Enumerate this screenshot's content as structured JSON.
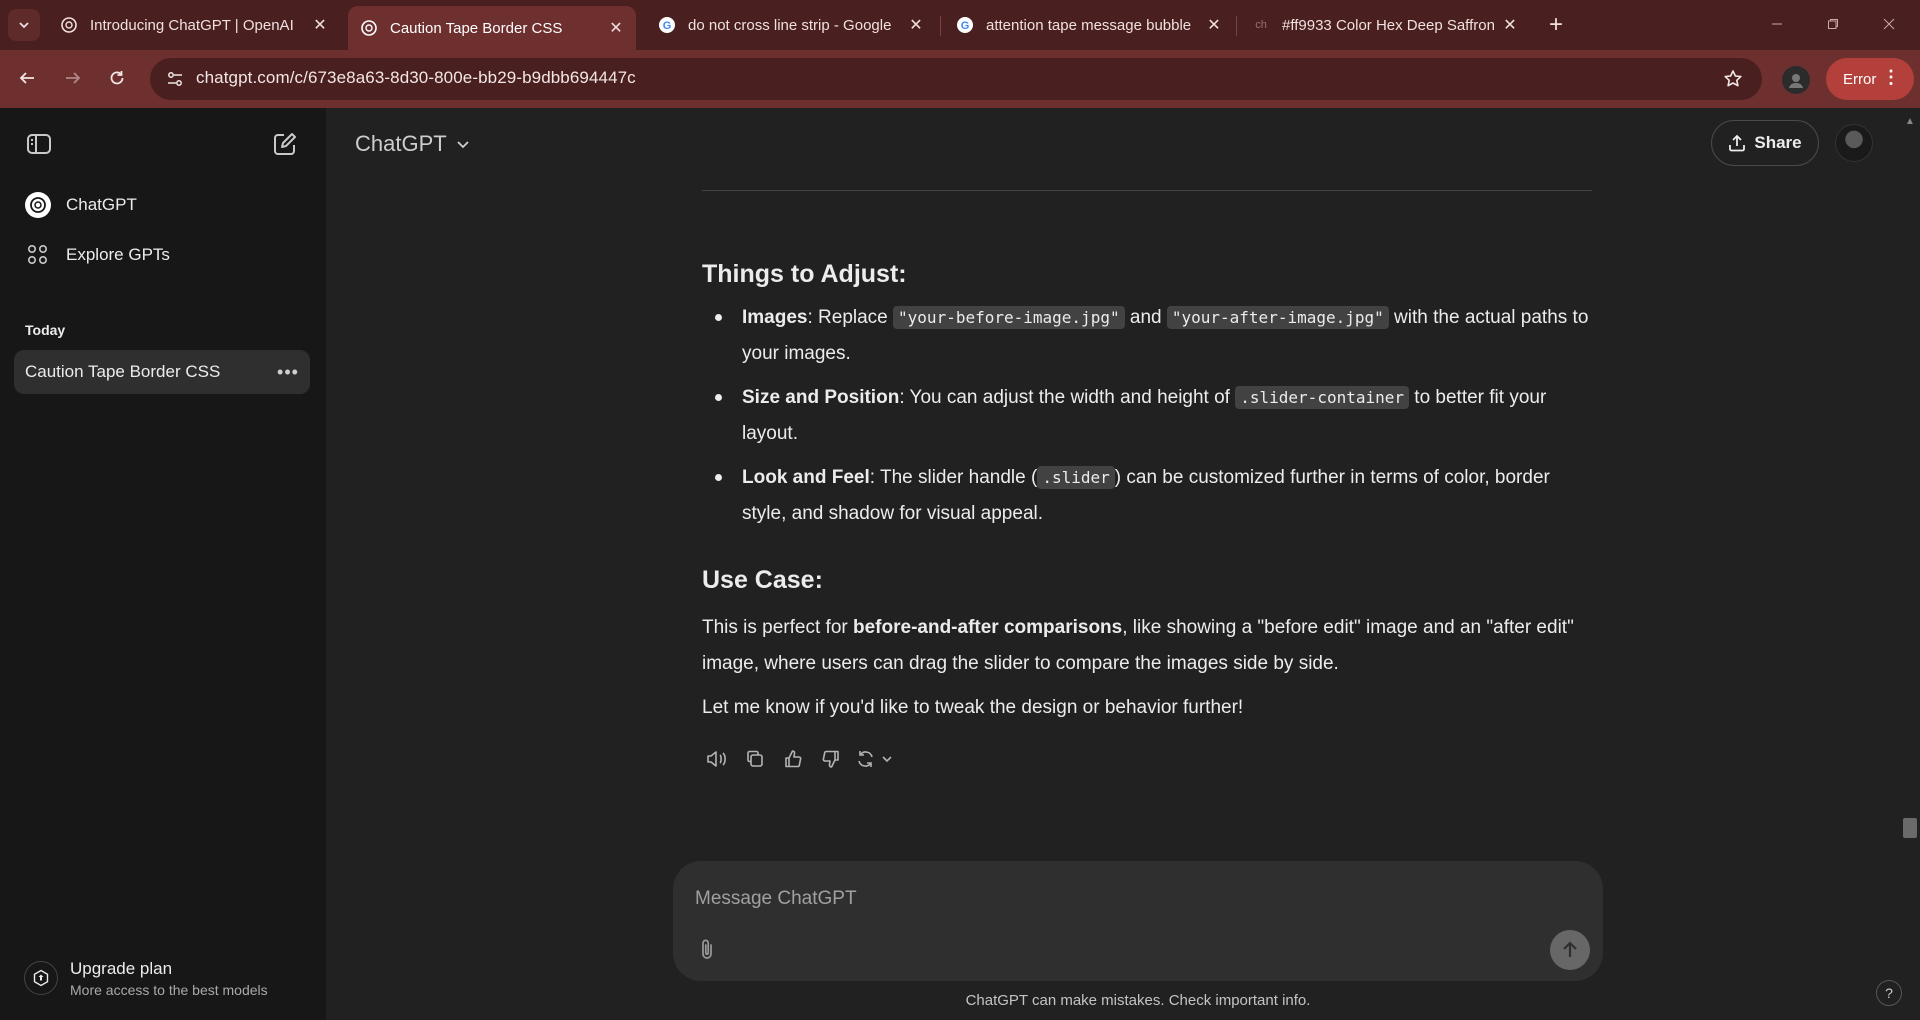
{
  "browser": {
    "tabs": [
      {
        "title": "Introducing ChatGPT | OpenAI",
        "active": false,
        "favicon": "openai-icon"
      },
      {
        "title": "Caution Tape Border CSS",
        "active": true,
        "favicon": "openai-icon"
      },
      {
        "title": "do not cross line strip - Google",
        "active": false,
        "favicon": "google-icon"
      },
      {
        "title": "attention tape message bubble",
        "active": false,
        "favicon": "google-icon"
      },
      {
        "title": "#ff9933 Color Hex Deep Saffron",
        "active": false,
        "favicon": "color-hex-icon"
      }
    ],
    "favicon_text": "ch",
    "url": "chatgpt.com/c/673e8a63-8d30-800e-bb29-b9dbb694447c",
    "error_label": "Error",
    "frame_color": "#6e2f2f",
    "error_color": "#b3403a"
  },
  "sidebar": {
    "nav": [
      {
        "label": "ChatGPT",
        "icon": "openai-icon"
      },
      {
        "label": "Explore GPTs",
        "icon": "grid-icon"
      }
    ],
    "section_today": "Today",
    "conversations": [
      {
        "title": "Caution Tape Border CSS"
      }
    ],
    "upgrade": {
      "title": "Upgrade plan",
      "subtitle": "More access to the best models"
    }
  },
  "header": {
    "model": "ChatGPT",
    "share_label": "Share"
  },
  "message": {
    "things_heading": "Things to Adjust:",
    "bullets": [
      {
        "strong": "Images",
        "t1": ": Replace ",
        "code1": "\"your-before-image.jpg\"",
        "t2": " and ",
        "code2": "\"your-after-image.jpg\"",
        "t3": " with the actual paths to your images."
      },
      {
        "strong": "Size and Position",
        "t1": ": You can adjust the width and height of ",
        "code1": ".slider-container",
        "t2": " to better fit your layout."
      },
      {
        "strong": "Look and Feel",
        "t1": ": The slider handle (",
        "code1": ".slider",
        "t2": ") can be customized further in terms of color, border style, and shadow for visual appeal."
      }
    ],
    "usecase_heading": "Use Case:",
    "usecase_p1_a": "This is perfect for ",
    "usecase_p1_strong": "before-and-after comparisons",
    "usecase_p1_b": ", like showing a \"before edit\" image and an \"after edit\" image, where users can drag the slider to compare the images side by side.",
    "closing": "Let me know if you'd like to tweak the design or behavior further!",
    "actions": [
      "read-aloud-icon",
      "copy-icon",
      "thumbs-up-icon",
      "thumbs-down-icon",
      "regenerate-icon"
    ]
  },
  "composer": {
    "placeholder": "Message ChatGPT",
    "disclaimer": "ChatGPT can make mistakes. Check important info.",
    "help": "?"
  }
}
